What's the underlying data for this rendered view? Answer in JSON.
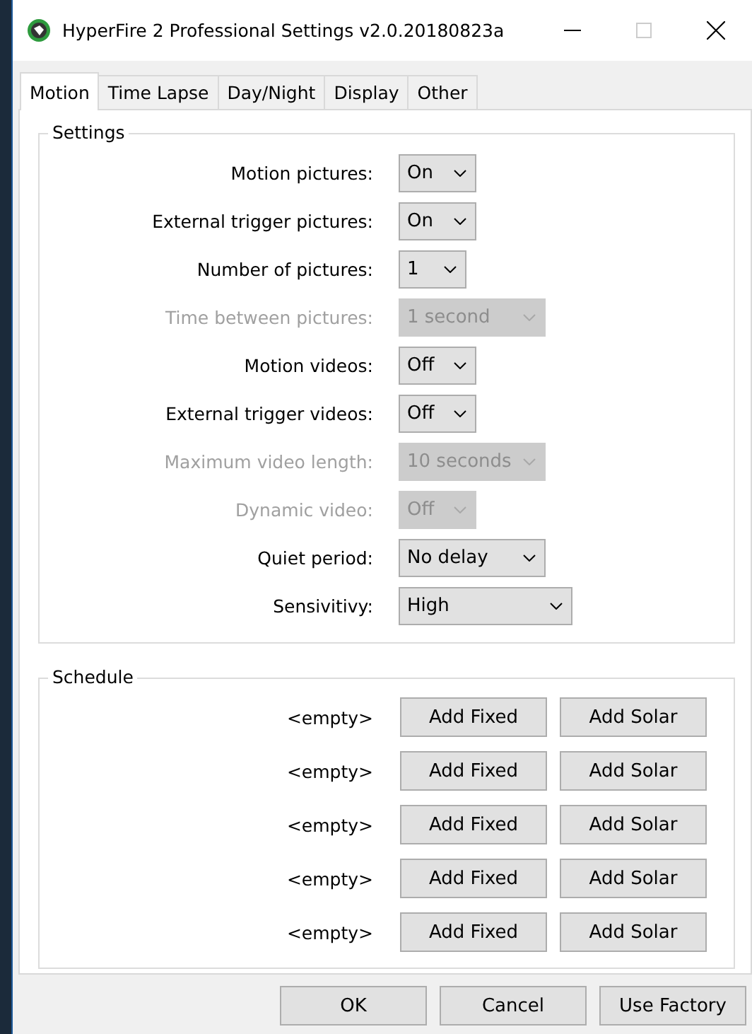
{
  "window": {
    "title": "HyperFire 2 Professional Settings v2.0.20180823a",
    "maximize_disabled": true
  },
  "tabs": [
    {
      "label": "Motion",
      "selected": true
    },
    {
      "label": "Time Lapse",
      "selected": false
    },
    {
      "label": "Day/Night",
      "selected": false
    },
    {
      "label": "Display",
      "selected": false
    },
    {
      "label": "Other",
      "selected": false
    }
  ],
  "settings": {
    "title": "Settings",
    "rows": [
      {
        "label": "Motion pictures:",
        "value": "On",
        "disabled": false
      },
      {
        "label": "External trigger pictures:",
        "value": "On",
        "disabled": false
      },
      {
        "label": "Number of pictures:",
        "value": "1",
        "disabled": false
      },
      {
        "label": "Time between pictures:",
        "value": "1 second",
        "disabled": true
      },
      {
        "label": "Motion videos:",
        "value": "Off",
        "disabled": false
      },
      {
        "label": "External trigger videos:",
        "value": "Off",
        "disabled": false
      },
      {
        "label": "Maximum video length:",
        "value": "10 seconds",
        "disabled": true
      },
      {
        "label": "Dynamic video:",
        "value": "Off",
        "disabled": true
      },
      {
        "label": "Quiet period:",
        "value": "No delay",
        "disabled": false
      },
      {
        "label": "Sensivitivy:",
        "value": "High",
        "disabled": false
      }
    ]
  },
  "schedule": {
    "title": "Schedule",
    "rows": [
      {
        "entry": "<empty>",
        "buttons": [
          "Add Fixed",
          "Add Solar"
        ]
      },
      {
        "entry": "<empty>",
        "buttons": [
          "Add Fixed",
          "Add Solar"
        ]
      },
      {
        "entry": "<empty>",
        "buttons": [
          "Add Fixed",
          "Add Solar"
        ]
      },
      {
        "entry": "<empty>",
        "buttons": [
          "Add Fixed",
          "Add Solar"
        ]
      },
      {
        "entry": "<empty>",
        "buttons": [
          "Add Fixed",
          "Add Solar"
        ]
      }
    ]
  },
  "buttons": [
    "OK",
    "Cancel",
    "Use Factory"
  ]
}
